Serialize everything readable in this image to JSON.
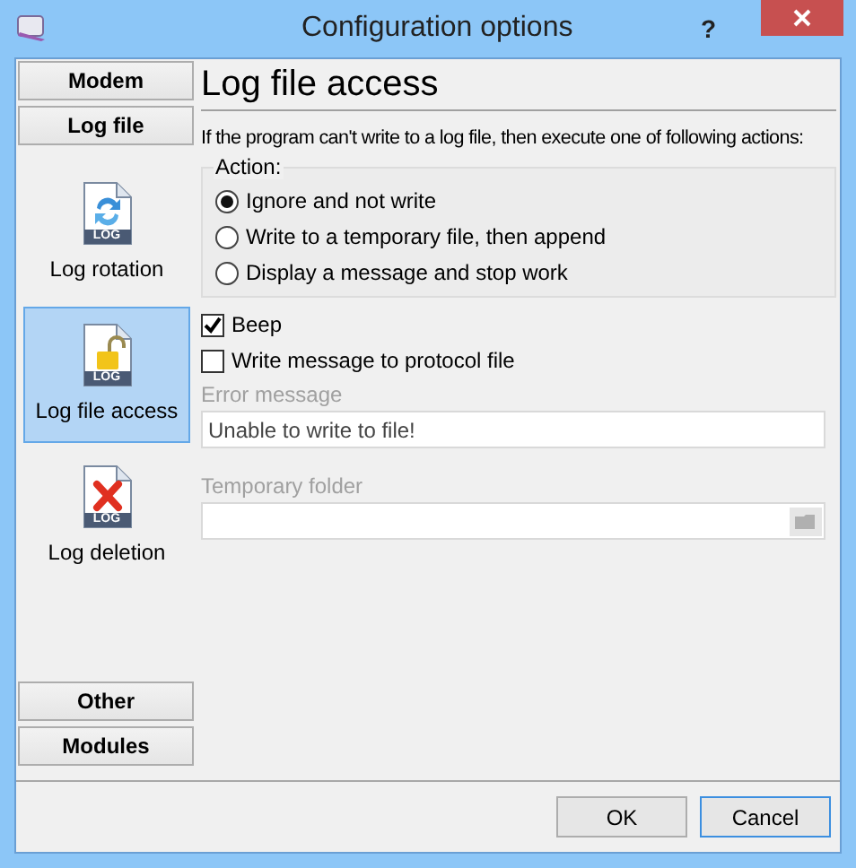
{
  "window": {
    "title": "Configuration options",
    "help": "?"
  },
  "sidebar": {
    "top_buttons": [
      {
        "label": "Modem"
      },
      {
        "label": "Log file"
      }
    ],
    "items": [
      {
        "label": "Log rotation",
        "icon_label": "LOG",
        "kind": "rotation",
        "selected": false
      },
      {
        "label": "Log file access",
        "icon_label": "LOG",
        "kind": "lock",
        "selected": true
      },
      {
        "label": "Log deletion",
        "icon_label": "LOG",
        "kind": "delete",
        "selected": false
      }
    ],
    "bottom_buttons": [
      {
        "label": "Other"
      },
      {
        "label": "Modules"
      }
    ]
  },
  "page": {
    "heading": "Log file access",
    "description": "If the program can't write to a log file, then execute one of following actions:",
    "action_group": {
      "legend": "Action:",
      "options": [
        {
          "label": "Ignore and not write",
          "selected": true
        },
        {
          "label": "Write to a temporary file, then append",
          "selected": false
        },
        {
          "label": "Display a message and stop work",
          "selected": false
        }
      ]
    },
    "checkboxes": [
      {
        "label": "Beep",
        "checked": true
      },
      {
        "label": "Write message to protocol file",
        "checked": false
      }
    ],
    "error_message": {
      "label": "Error message",
      "value": "Unable to write to file!"
    },
    "temporary_folder": {
      "label": "Temporary folder"
    }
  },
  "buttons": [
    {
      "label": "OK",
      "default": false
    },
    {
      "label": "Cancel",
      "default": true
    }
  ]
}
